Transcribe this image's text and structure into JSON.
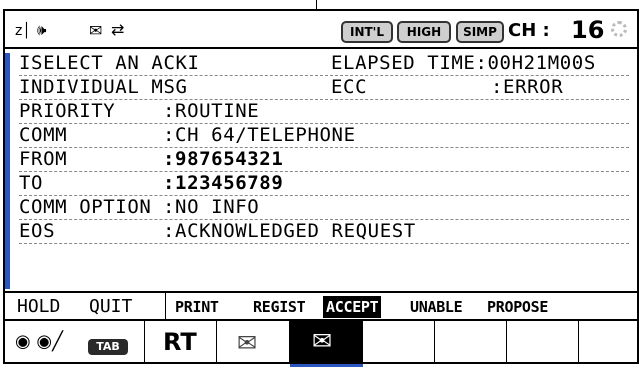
{
  "status_bar": {
    "antenna_icon": "signal-antenna-icon",
    "speaker_icon": "speaker-icon",
    "mail_icon": "envelope-icon",
    "mail_exchange_icon": "envelope-exchange-icon",
    "badges": [
      "INT'L",
      "HIGH",
      "SIMP"
    ],
    "channel_label": "CH :",
    "channel_value": "16",
    "spinner_icon": "busy-spinner-icon"
  },
  "message": {
    "row0": {
      "left": "ISELECT AN ACKI",
      "right": "ELAPSED TIME:00H21M00S"
    },
    "row1": {
      "left": "INDIVIDUAL MSG",
      "mid": "ECC",
      "right": ":ERROR"
    },
    "fields": [
      {
        "label": "PRIORITY",
        "value": ":ROUTINE"
      },
      {
        "label": "COMM",
        "value": ":CH 64/TELEPHONE"
      },
      {
        "label": "FROM",
        "value": ":987654321"
      },
      {
        "label": "TO",
        "value": ":123456789"
      },
      {
        "label": "COMM OPTION",
        "value": ":NO INFO"
      },
      {
        "label": "EOS",
        "value": ":ACKNOWLEDGED REQUEST"
      }
    ]
  },
  "softkeys": {
    "hold": "HOLD",
    "quit": "QUIT",
    "print": "PRINT",
    "regist": "REGIST",
    "accept": "ACCEPT",
    "unable": "UNABLE",
    "propose": "PROPOSE"
  },
  "tabs": {
    "tab_button": "TAB",
    "rt": "RT",
    "icons": [
      "radar-eyes-icon",
      "send-mail-icon",
      "received-mail-icon"
    ]
  },
  "colors": {
    "accent_blue": "#2b56c0",
    "badge_gray": "#cfcfcf"
  }
}
